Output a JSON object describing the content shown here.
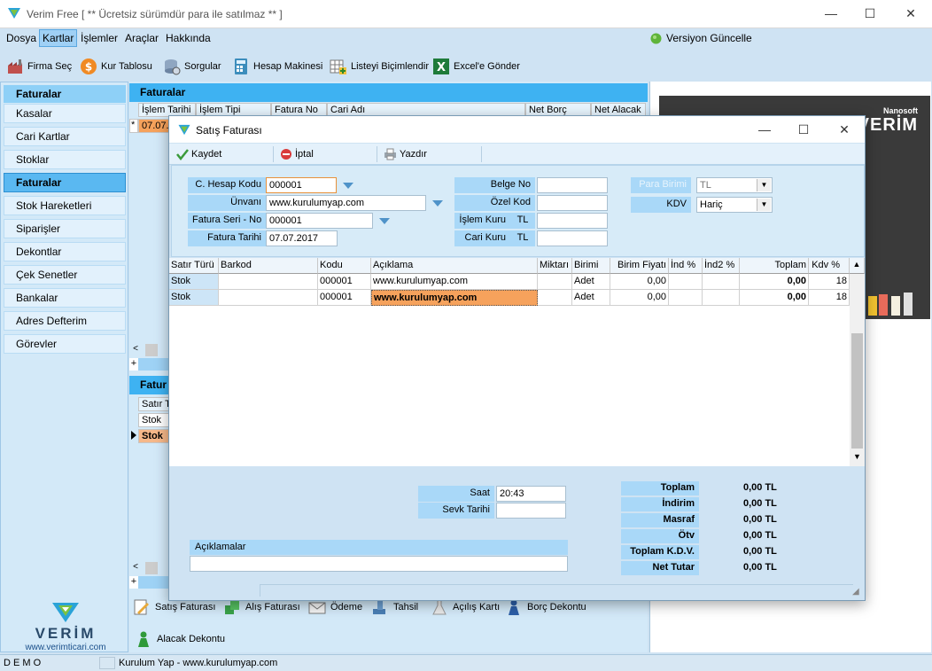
{
  "app": {
    "title": "Verim Free  [  ** Ücretsiz sürümdür para ile satılmaz **  ]"
  },
  "menu": [
    "Dosya",
    "Kartlar",
    "İşlemler",
    "Araçlar",
    "Hakkında"
  ],
  "menu_update": "Versiyon Güncelle",
  "toolbar": [
    "Firma Seç",
    "Kur Tablosu",
    "Sorgular",
    "Hesap Makinesi",
    "Listeyi Biçimlendir",
    "Excel'e Gönder"
  ],
  "sidebar": {
    "header": "Faturalar",
    "items": [
      "Kasalar",
      "Cari Kartlar",
      "Stoklar",
      "Faturalar",
      "Stok Hareketleri",
      "Siparişler",
      "Dekontlar",
      "Çek Senetler",
      "Bankalar",
      "Adres Defterim",
      "Görevler"
    ],
    "brand": "VERİM",
    "url": "www.verimticari.com"
  },
  "center": {
    "header": "Faturalar",
    "cols": [
      "İşlem Tarihi",
      "İşlem Tipi",
      "Fatura No",
      "Cari Adı",
      "Net Borç",
      "Net Alacak"
    ],
    "row1_marker": "*",
    "row1_date": "07.07.",
    "header2": "Fatur",
    "sub_col": "Satır T",
    "sub_rows": [
      "Stok",
      "Stok"
    ]
  },
  "bottom_toolbar": [
    "Satış Faturası",
    "Alış Faturası",
    "Ödeme",
    "Tahsil",
    "Açılış Kartı",
    "Borç Dekontu",
    "Alacak Dekontu"
  ],
  "banner": {
    "brand": "Nanosoft",
    "name": "VERİM"
  },
  "status": {
    "left": "D E M O",
    "text": "Kurulum Yap - www.kurulumyap.com"
  },
  "dialog": {
    "title": "Satış Faturası",
    "toolbar": [
      "Kaydet",
      "İptal",
      "Yazdır"
    ],
    "form": {
      "hesap_kodu_label": "C. Hesap Kodu",
      "hesap_kodu": "000001",
      "unvan_label": "Ünvanı",
      "unvan": "www.kurulumyap.com",
      "seri_label": "Fatura Seri - No",
      "seri": "000001",
      "tarih_label": "Fatura Tarihi",
      "tarih": "07.07.2017",
      "belge_label": "Belge No",
      "belge": "",
      "ozel_label": "Özel Kod",
      "ozel": "",
      "islem_kuru_label": "İşlem Kuru",
      "islem_kuru_unit": "TL",
      "cari_kuru_label": "Cari Kuru",
      "cari_kuru_unit": "TL",
      "para_label": "Para Birimi",
      "para": "TL",
      "kdv_label": "KDV",
      "kdv": "Hariç"
    },
    "grid": {
      "headers": [
        "Satır Türü",
        "Barkod",
        "Kodu",
        "Açıklama",
        "Miktarı",
        "Birimi",
        "Birim Fiyatı",
        "İnd %",
        "İnd2 %",
        "Toplam",
        "Kdv %"
      ],
      "rows": [
        [
          "Stok",
          "",
          "000001",
          "www.kurulumyap.com",
          "",
          "Adet",
          "0,00",
          "",
          "",
          "0,00",
          "18"
        ],
        [
          "Stok",
          "",
          "000001",
          "www.kurulumyap.com",
          "",
          "Adet",
          "0,00",
          "",
          "",
          "0,00",
          "18"
        ]
      ]
    },
    "footer": {
      "saat_label": "Saat",
      "saat": "20:43",
      "sevk_label": "Sevk Tarihi",
      "sevk": "",
      "aciklama_label": "Açıklamalar",
      "totals": [
        {
          "label": "Toplam",
          "value": "0,00 TL"
        },
        {
          "label": "İndirim",
          "value": "0,00 TL"
        },
        {
          "label": "Masraf",
          "value": "0,00 TL"
        },
        {
          "label": "Ötv",
          "value": "0,00 TL"
        },
        {
          "label": "Toplam K.D.V.",
          "value": "0,00 TL"
        },
        {
          "label": "Net Tutar",
          "value": "0,00 TL"
        }
      ]
    }
  }
}
